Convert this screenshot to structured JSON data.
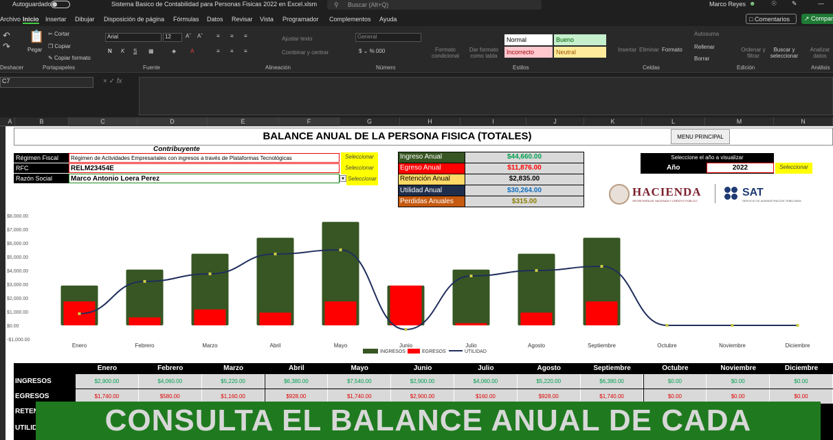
{
  "titlebar": {
    "autosave": "Autoguardado",
    "file": "Sistema Basico de Contabilidad para Personas Fisicas 2022 en Excel.xlsm",
    "search": "Buscar (Alt+Q)",
    "user": "Marco Reyes"
  },
  "tabs": [
    "Archivo",
    "Inicio",
    "Insertar",
    "Dibujar",
    "Disposición de página",
    "Fórmulas",
    "Datos",
    "Revisar",
    "Vista",
    "Programador",
    "Complementos",
    "Ayuda"
  ],
  "tab_comments": "Comentarios",
  "tab_share": "Compartir",
  "ribbon": {
    "cortar": "Cortar",
    "copiar": "Copiar",
    "copiar_formato": "Copiar formato",
    "pegar": "Pegar",
    "deshacer": "Deshacer",
    "portapapeles": "Portapapeles",
    "font": "Arial",
    "size": "12",
    "fuente": "Fuente",
    "ajustar": "Ajustar texto",
    "combinar": "Combinar y centrar",
    "alineacion": "Alineación",
    "numfmt": "General",
    "numero": "Número",
    "formato_cond": "Formato condicional",
    "dar_formato": "Dar formato como tabla",
    "style_normal": "Normal",
    "style_bueno": "Bueno",
    "style_incorrecto": "Incorrecto",
    "style_neutral": "Neutral",
    "estilos": "Estilos",
    "insertar": "Insertar",
    "eliminar": "Eliminar",
    "formato": "Formato",
    "celdas": "Celdas",
    "autosuma": "Autosuma",
    "rellenar": "Rellenar",
    "borrar": "Borrar",
    "ordenar": "Ordenar y filtrar",
    "buscar": "Buscar y seleccionar",
    "edicion": "Edición",
    "analizar": "Analizar datos",
    "analisis": "Análisis"
  },
  "namebox": "C7",
  "columns": [
    "A",
    "B",
    "C",
    "D",
    "E",
    "F",
    "G",
    "H",
    "I",
    "J",
    "K",
    "L",
    "M",
    "N"
  ],
  "report": {
    "title": "BALANCE ANUAL DE LA PERSONA FISICA (TOTALES)",
    "menu": "MENU PRINCIPAL",
    "contribuyente": "Contribuyente",
    "regimen_label": "Régimen Fiscal",
    "regimen_value": "Régimen de Actividades Empresariales con ingresos a través de Plataformas Tecnológicas",
    "rfc_label": "RFC",
    "rfc_value": "RELM23454E",
    "razon_label": "Razón Social",
    "razon_value": "Marco Antonio Loera Perez",
    "seleccionar": "Seleccionar",
    "ingreso_label": "Ingreso Anual",
    "ingreso_value": "$44,660.00",
    "egreso_label": "Egreso Anual",
    "egreso_value": "$11,876.00",
    "retencion_label": "Retención Anual",
    "retencion_value": "$2,835.00",
    "utilidad_label": "Utilidad Anual",
    "utilidad_value": "$30,264.00",
    "perdidas_label": "Perdidas Anuales",
    "perdidas_value": "$315.00",
    "year_prompt": "Seleccione el año a visualizar",
    "year_label": "Año",
    "year_value": "2022",
    "hacienda": "HACIENDA",
    "hacienda_sub": "SECRETARÍA DE HACIENDA Y CRÉDITO PÚBLICO",
    "sat": "SAT",
    "sat_sub": "SERVICIO DE ADMINISTRACIÓN TRIBUTARIA"
  },
  "chart_data": {
    "type": "bar",
    "categories": [
      "Enero",
      "Febrero",
      "Marzo",
      "Abril",
      "Mayo",
      "Junio",
      "Julio",
      "Agosto",
      "Septiembre",
      "Octubre",
      "Noviembre",
      "Diciembre"
    ],
    "series": [
      {
        "name": "INGRESOS",
        "values": [
          2900,
          4060,
          5220,
          6380,
          7540,
          2900,
          4060,
          5220,
          6380,
          0,
          0,
          0
        ]
      },
      {
        "name": "EGRESOS",
        "values": [
          1740,
          580,
          1160,
          928,
          1740,
          2900,
          160,
          928,
          1740,
          0,
          0,
          0
        ]
      },
      {
        "name": "UTILIDAD",
        "values": [
          850,
          3200,
          3750,
          5200,
          5500,
          -300,
          3600,
          4000,
          4300,
          0,
          0,
          0
        ]
      }
    ],
    "yticks": [
      "$8,000.00",
      "$7,000.00",
      "$6,000.00",
      "$5,000.00",
      "$4,000.00",
      "$3,000.00",
      "$2,000.00",
      "$1,000.00",
      "$0.00",
      "-$1,000.00"
    ],
    "ylim": [
      -1000,
      8000
    ],
    "colors": {
      "ingresos": "#375623",
      "egresos": "#ff0000",
      "utilidad": "#1f2e5c"
    }
  },
  "table": {
    "months": [
      "Enero",
      "Febrero",
      "Marzo",
      "Abril",
      "Mayo",
      "Junio",
      "Julio",
      "Agosto",
      "Septiembre",
      "Octubre",
      "Noviembre",
      "Diciembre"
    ],
    "rows": [
      {
        "label": "INGRESOS",
        "values": [
          "$2,900.00",
          "$4,060.00",
          "$5,220.00",
          "$6,380.00",
          "$7,540.00",
          "$2,900.00",
          "$4,060.00",
          "$5,220.00",
          "$6,380.00",
          "$0.00",
          "$0.00",
          "$0.00"
        ]
      },
      {
        "label": "EGRESOS",
        "values": [
          "$1,740.00",
          "$580.00",
          "$1,160.00",
          "$928.00",
          "$1,740.00",
          "$2,900.00",
          "$160.00",
          "$928.00",
          "$1,740.00",
          "$0.00",
          "$0.00",
          "$0.00"
        ]
      }
    ],
    "partial_labels": [
      "RETEN",
      "UTILID"
    ]
  },
  "banner": "CONSULTA EL BALANCE ANUAL DE CADA"
}
